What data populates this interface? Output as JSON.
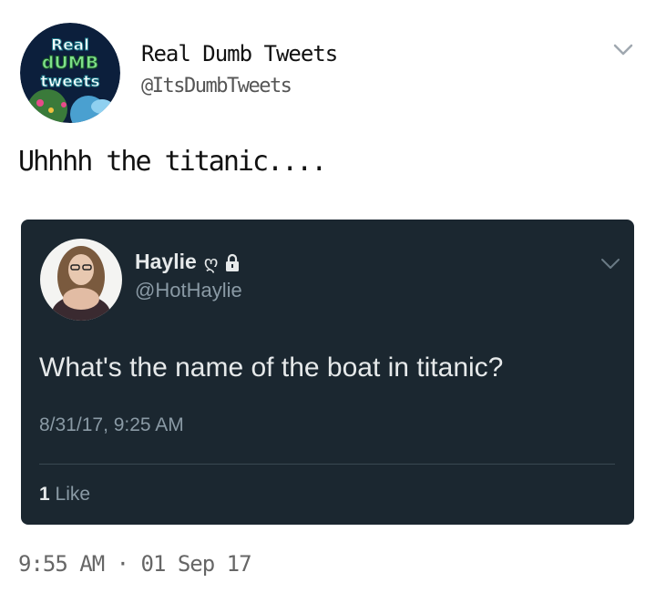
{
  "author": {
    "avatar_text": [
      "Real",
      "dUMB",
      "tweets"
    ],
    "name": "Real Dumb Tweets",
    "handle": "@ItsDumbTweets"
  },
  "tweet": {
    "text": "Uhhhh the titanic....",
    "timestamp": "9:55 AM · 01 Sep 17"
  },
  "quoted": {
    "name": "Haylie",
    "name_emoji": "ღ",
    "handle": "@HotHaylie",
    "text": "What's the name of the boat in titanic?",
    "date": "8/31/17, 9:25 AM",
    "likes_count": "1",
    "likes_label": "Like"
  },
  "colors": {
    "quote_bg": "#1b2730",
    "quote_text": "#e6e9ea",
    "quote_secondary": "#8a9aa5",
    "page_bg": "#ffffff"
  },
  "icons": [
    "chevron-down-icon",
    "lock-icon"
  ]
}
